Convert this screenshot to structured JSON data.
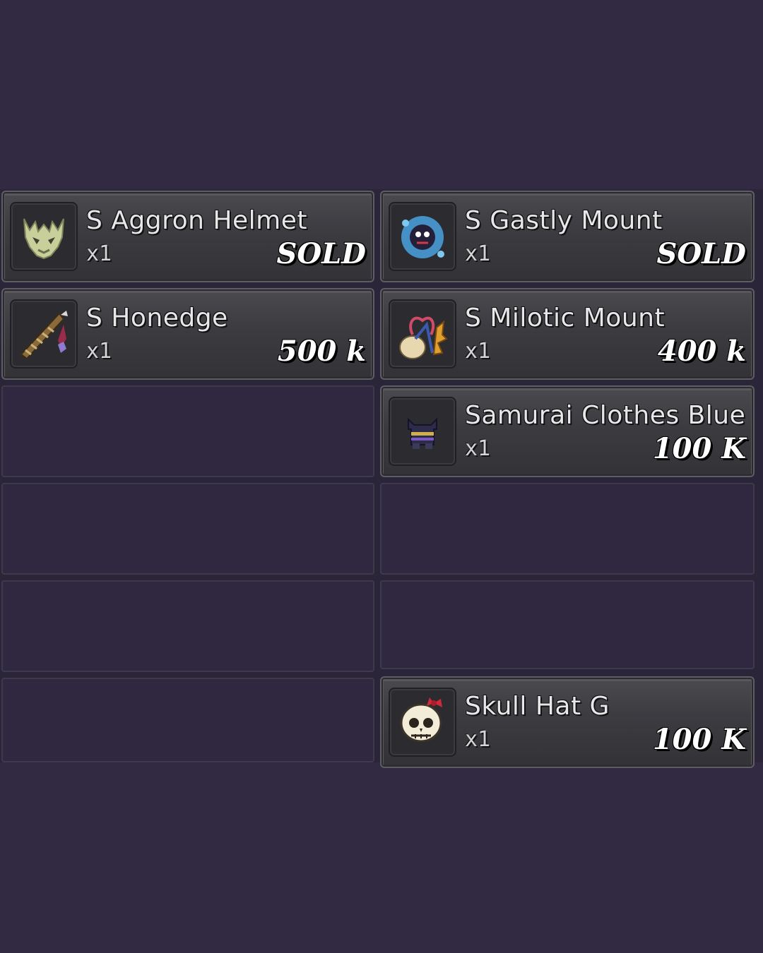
{
  "items": [
    {
      "name": "S Aggron Helmet",
      "qty": "x1",
      "price": "SOLD",
      "icon": "aggron-helmet-icon"
    },
    {
      "name": "S Gastly Mount",
      "qty": "x1",
      "price": "SOLD",
      "icon": "gastly-mount-icon"
    },
    {
      "name": "S Honedge",
      "qty": "x1",
      "price": "500 k",
      "icon": "honedge-sword-icon"
    },
    {
      "name": "S Milotic Mount",
      "qty": "x1",
      "price": "400 k",
      "icon": "milotic-mount-icon"
    },
    {
      "name": "Samurai Clothes Blue",
      "qty": "x1",
      "price": "100 K",
      "icon": "samurai-clothes-icon"
    },
    {
      "name": "Skull Hat G",
      "qty": "x1",
      "price": "100 K",
      "icon": "skull-hat-icon"
    }
  ],
  "colors": {
    "background": "#322a42",
    "empty_slot": "#2f2840",
    "price_text": "#ffffff"
  }
}
